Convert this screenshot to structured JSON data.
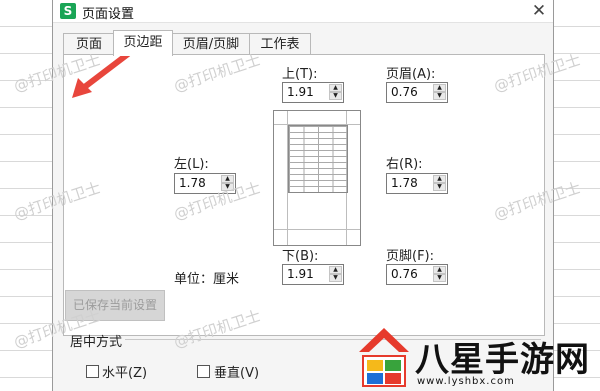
{
  "dialog": {
    "app_icon": "S",
    "title": "页面设置",
    "close_glyph": "✕"
  },
  "tabs": [
    {
      "label": "页面",
      "active": false
    },
    {
      "label": "页边距",
      "active": true
    },
    {
      "label": "页眉/页脚",
      "active": false
    },
    {
      "label": "工作表",
      "active": false
    }
  ],
  "margins": {
    "top": {
      "label": "上(T):",
      "value": "1.91"
    },
    "header": {
      "label": "页眉(A):",
      "value": "0.76"
    },
    "left": {
      "label": "左(L):",
      "value": "1.78"
    },
    "right": {
      "label": "右(R):",
      "value": "1.78"
    },
    "bottom": {
      "label": "下(B):",
      "value": "1.91"
    },
    "footer": {
      "label": "页脚(F):",
      "value": "0.76"
    }
  },
  "unit": {
    "label": "单位：厘米"
  },
  "save_button": {
    "label": "已保存当前设置",
    "enabled": false
  },
  "centering": {
    "title": "居中方式",
    "horizontal": {
      "label": "水平(Z)",
      "checked": false
    },
    "vertical": {
      "label": "垂直(V)",
      "checked": false
    }
  },
  "watermark_text": "@打印机卫士",
  "brand": {
    "name": "八星手游网",
    "url": "www.lyshbx.com",
    "colors": {
      "red": "#e63a2c",
      "yellow": "#f5b91a",
      "green": "#38a33c",
      "blue": "#1d6fd6",
      "arrow": "#e8463c"
    }
  }
}
